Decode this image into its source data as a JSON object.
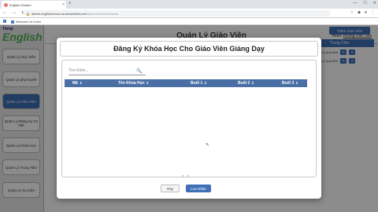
{
  "browser": {
    "tab_title": "English Garden",
    "url_host": "admin.englishschool.azurewebsites.net",
    "url_path": "/admin/teacher/teacher",
    "bookmark": "Welcome to Linter"
  },
  "sidebar": {
    "logo_top": "Tieng",
    "logo_main": "English",
    "items": [
      {
        "label": "Quản Lý Học Viên"
      },
      {
        "label": "Quản Lý phụ huynh"
      },
      {
        "label": "Quản Lý Giáo Viên"
      },
      {
        "label": "Quản Lý Đăng Ký Tư Vấn"
      },
      {
        "label": "Quản Lý Khóa Học"
      },
      {
        "label": "Quản Lý Trung Tâm"
      },
      {
        "label": "Quản Lý Xu Kiện"
      }
    ]
  },
  "header": {
    "title": "Quản Lý Giáo Viên",
    "hello_prefix": "Hello!",
    "user_name": "Hoàng Văn Tâm",
    "add_button": "Thêm Giáo Viên"
  },
  "bg_table": {
    "header": "Trung Tâm",
    "rows": [
      "Lý Quý Đôn",
      "Lý Quý Đôn"
    ]
  },
  "modal": {
    "title": "Đăng Ký Khóa Học Cho Giáo Viên Giảng Dạy",
    "search_placeholder": "Tìm Kiếm...",
    "columns": [
      "Mã",
      "Tên Khóa Học",
      "Buổi 1",
      "Buổi 2",
      "Buổi 3"
    ],
    "cancel_label": "Hủy",
    "save_label": "Lưu Nhận"
  },
  "colors": {
    "primary": "#3f6fb6",
    "table_header": "#4a6fa5"
  }
}
